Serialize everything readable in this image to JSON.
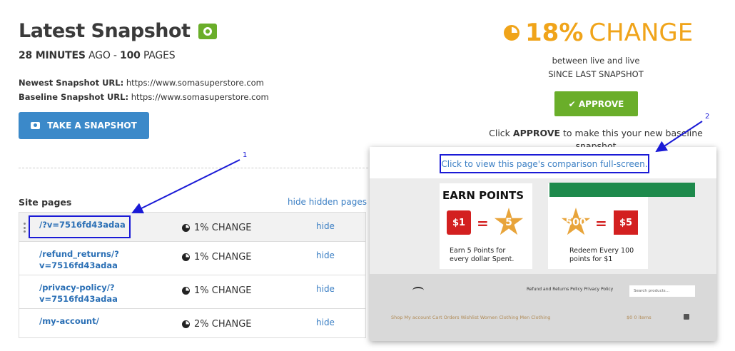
{
  "header": {
    "title": "Latest Snapshot",
    "time_ago_value": "28 MINUTES",
    "time_ago_suffix": "AGO",
    "separator": "-",
    "pages_count": "100",
    "pages_label": "PAGES"
  },
  "urls": {
    "newest_label": "Newest Snapshot URL:",
    "newest_value": "https://www.somasuperstore.com",
    "baseline_label": "Baseline Snapshot URL:",
    "baseline_value": "https://www.somasuperstore.com"
  },
  "take_snapshot_label": "TAKE A SNAPSHOT",
  "site_pages": {
    "heading": "Site pages",
    "hide_hidden_label": "hide hidden pages",
    "rows": [
      {
        "path": "/?v=7516fd43adaa",
        "change": "1% CHANGE",
        "hide": "hide"
      },
      {
        "path": "/refund_returns/?v=7516fd43adaa",
        "change": "1% CHANGE",
        "hide": "hide"
      },
      {
        "path": "/privacy-policy/?v=7516fd43adaa",
        "change": "1% CHANGE",
        "hide": "hide"
      },
      {
        "path": "/my-account/",
        "change": "2% CHANGE",
        "hide": "hide"
      }
    ]
  },
  "summary": {
    "percent": "18%",
    "change_word": "CHANGE",
    "line1": "between live and live",
    "line2": "SINCE LAST SNAPSHOT",
    "approve_label": "✔ APPROVE",
    "note_prefix": "Click",
    "note_bold": "APPROVE",
    "note_suffix": "to make this your new baseline snapshot"
  },
  "preview": {
    "fullscreen_link": "Click to view this page's comparison full-screen.",
    "earn_title": "EARN POINTS",
    "earn_price": "$1",
    "earn_points": "5",
    "earn_caption_1": "Earn 5 Points for",
    "earn_caption_2": "every dollar Spent.",
    "redeem_points": "500",
    "redeem_price": "$5",
    "redeem_caption_1": "Redeem Every 100",
    "redeem_caption_2": "points for $1",
    "footer_links": "Refund and Returns Policy    Privacy Policy",
    "search_placeholder": "Search products…",
    "menu_items": "Shop    My account    Cart    Orders    Wishlist    Women Clothing    Men Clothing",
    "menu_right": "$0 0 items"
  },
  "annotations": {
    "marker_1": "1",
    "marker_2": "2",
    "color": "#1a1ad6"
  },
  "colors": {
    "accent_orange": "#f0a41a",
    "approve_green": "#6aae2a",
    "snapshot_blue": "#3b89c9",
    "link_blue": "#3b7fc4"
  }
}
